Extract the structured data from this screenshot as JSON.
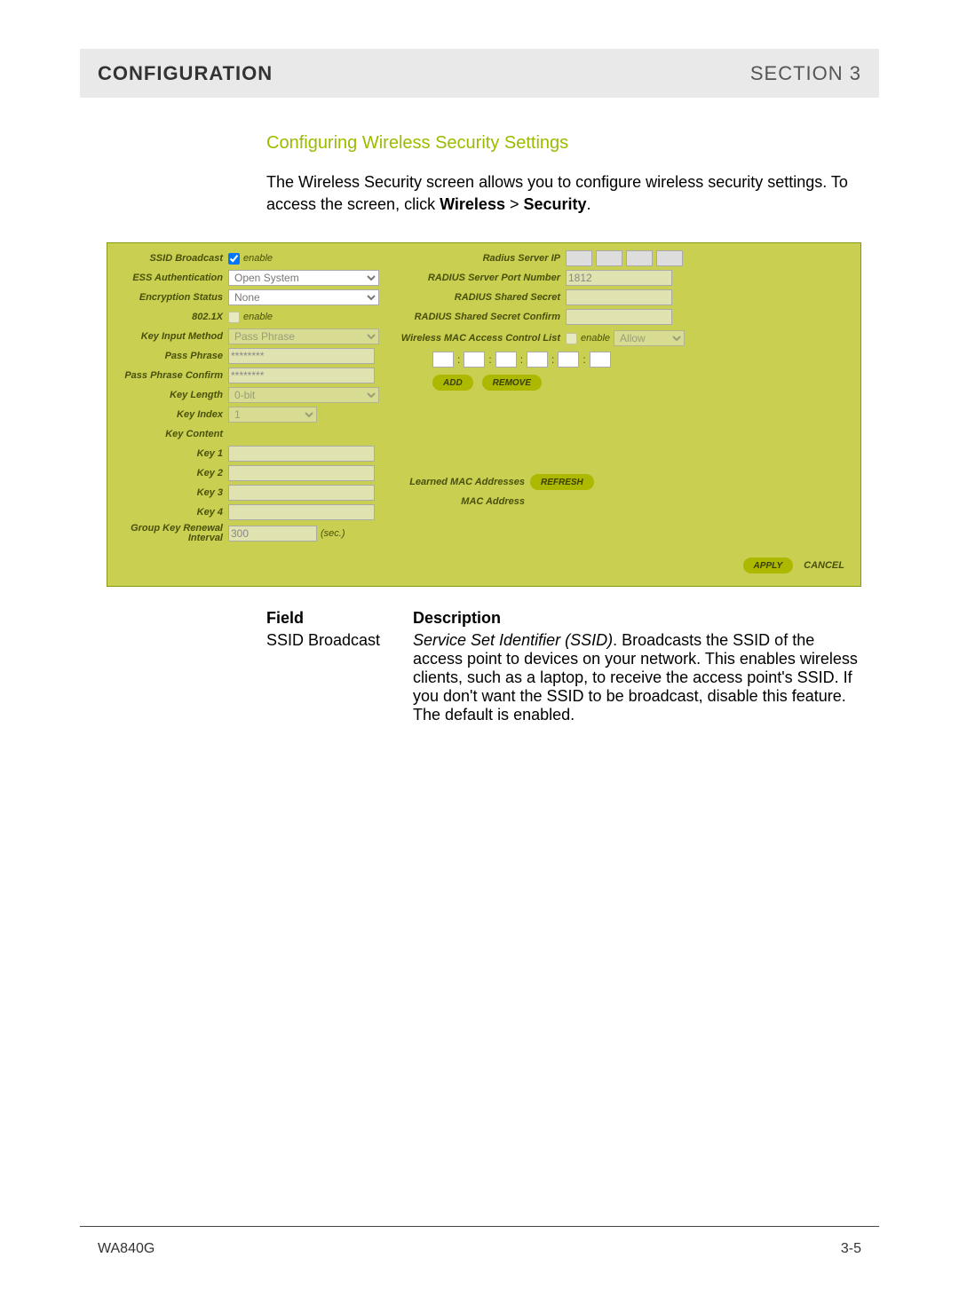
{
  "header": {
    "left": "CONFIGURATION",
    "right": "SECTION 3"
  },
  "section_heading": "Configuring Wireless Security Settings",
  "intro": {
    "part1": "The Wireless Security screen allows you to configure wireless security settings. To access the screen, click ",
    "bold1": "Wireless",
    "sep": " > ",
    "bold2": "Security",
    "end": "."
  },
  "form": {
    "left": {
      "ssid_broadcast_label": "SSID Broadcast",
      "ssid_enable": "enable",
      "ess_auth_label": "ESS Authentication",
      "ess_auth_value": "Open System",
      "enc_status_label": "Encryption Status",
      "enc_status_value": "None",
      "dot1x_label": "802.1X",
      "dot1x_enable": "enable",
      "key_input_label": "Key Input Method",
      "key_input_value": "Pass Phrase",
      "pass_phrase_label": "Pass Phrase",
      "pass_phrase_value": "********",
      "pass_phrase_confirm_label": "Pass Phrase Confirm",
      "pass_phrase_confirm_value": "********",
      "key_length_label": "Key Length",
      "key_length_value": "0-bit",
      "key_index_label": "Key Index",
      "key_index_value": "1",
      "key_content_label": "Key Content",
      "key1_label": "Key 1",
      "key2_label": "Key 2",
      "key3_label": "Key 3",
      "key4_label": "Key 4",
      "group_key_label": "Group Key Renewal Interval",
      "group_key_value": "300",
      "group_key_unit": "(sec.)"
    },
    "right": {
      "radius_ip_label": "Radius Server IP",
      "radius_port_label": "RADIUS Server Port Number",
      "radius_port_value": "1812",
      "radius_secret_label": "RADIUS Shared Secret",
      "radius_secret_confirm_label": "RADIUS Shared Secret Confirm",
      "mac_ctrl_label": "Wireless MAC Access Control List",
      "mac_ctrl_enable": "enable",
      "mac_ctrl_mode": "Allow",
      "add_btn": "ADD",
      "remove_btn": "REMOVE",
      "learned_mac_label": "Learned MAC Addresses",
      "refresh_btn": "REFRESH",
      "mac_address_label": "MAC Address"
    },
    "buttons": {
      "apply": "APPLY",
      "cancel": "CANCEL"
    }
  },
  "table": {
    "head_field": "Field",
    "head_desc": "Description",
    "row1_field": "SSID Broadcast",
    "row1_desc_italic": "Service Set Identifier (SSID)",
    "row1_desc_rest": ". Broadcasts the SSID of the access point to devices on your network. This enables wireless clients, such as a laptop, to receive the access point's SSID. If you don't want the SSID to be broadcast, disable this feature. The default is enabled."
  },
  "footer": {
    "model": "WA840G",
    "page": "3-5"
  }
}
